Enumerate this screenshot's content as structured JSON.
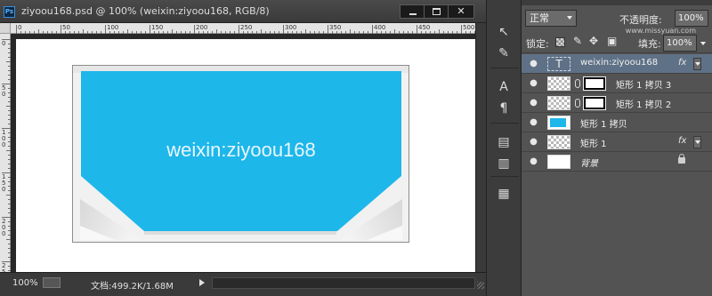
{
  "document": {
    "ps_badge": "Ps",
    "title": "ziyoou168.psd @ 100% (weixin:ziyoou168, RGB/8)",
    "close_glyph": "✕",
    "ruler_top_labels": [
      "0",
      "50",
      "100",
      "150",
      "200",
      "250",
      "300",
      "350",
      "400",
      "450",
      "500"
    ],
    "ruler_left_labels": [
      "0",
      "5\n0",
      "1\n0\n0",
      "1\n5\n0",
      "2\n0\n0",
      "2\n5\n0"
    ],
    "canvas_text": "weixin:ziyoou168",
    "canvas_color": "#1db7ea",
    "status": {
      "zoom": "100%",
      "doc_size": "文档:499.2K/1.68M"
    }
  },
  "tools": {
    "items": [
      {
        "name": "path-selection-icon",
        "glyph": "↖"
      },
      {
        "name": "direct-selection-icon",
        "glyph": "✎"
      },
      {
        "name": "type-tool-icon",
        "glyph": "A"
      },
      {
        "name": "paragraph-icon",
        "glyph": "¶"
      },
      {
        "name": "history-icon",
        "glyph": "▤"
      },
      {
        "name": "actions-icon",
        "glyph": "▥"
      },
      {
        "name": "brush-presets-icon",
        "glyph": "▦"
      }
    ]
  },
  "layers_panel": {
    "blend_mode": "正常",
    "opacity_label": "不透明度:",
    "opacity_value": "100%",
    "watermark": "www.missyuan.com",
    "lock_label": "锁定:",
    "fill_label": "填充:",
    "fill_value": "100%",
    "eye_glyph": "●",
    "fx_label": "fx",
    "layers": [
      {
        "name": "weixin:ziyoou168",
        "thumb": "T",
        "selected": true,
        "fx": true
      },
      {
        "name": "矩形 1 拷贝 3",
        "mask": true
      },
      {
        "name": "矩形 1 拷贝 2",
        "mask": true
      },
      {
        "name": "矩形 1 拷贝",
        "shape_thumb": true
      },
      {
        "name": "矩形 1",
        "fx": true
      },
      {
        "name": "背景",
        "locked": true
      }
    ]
  }
}
